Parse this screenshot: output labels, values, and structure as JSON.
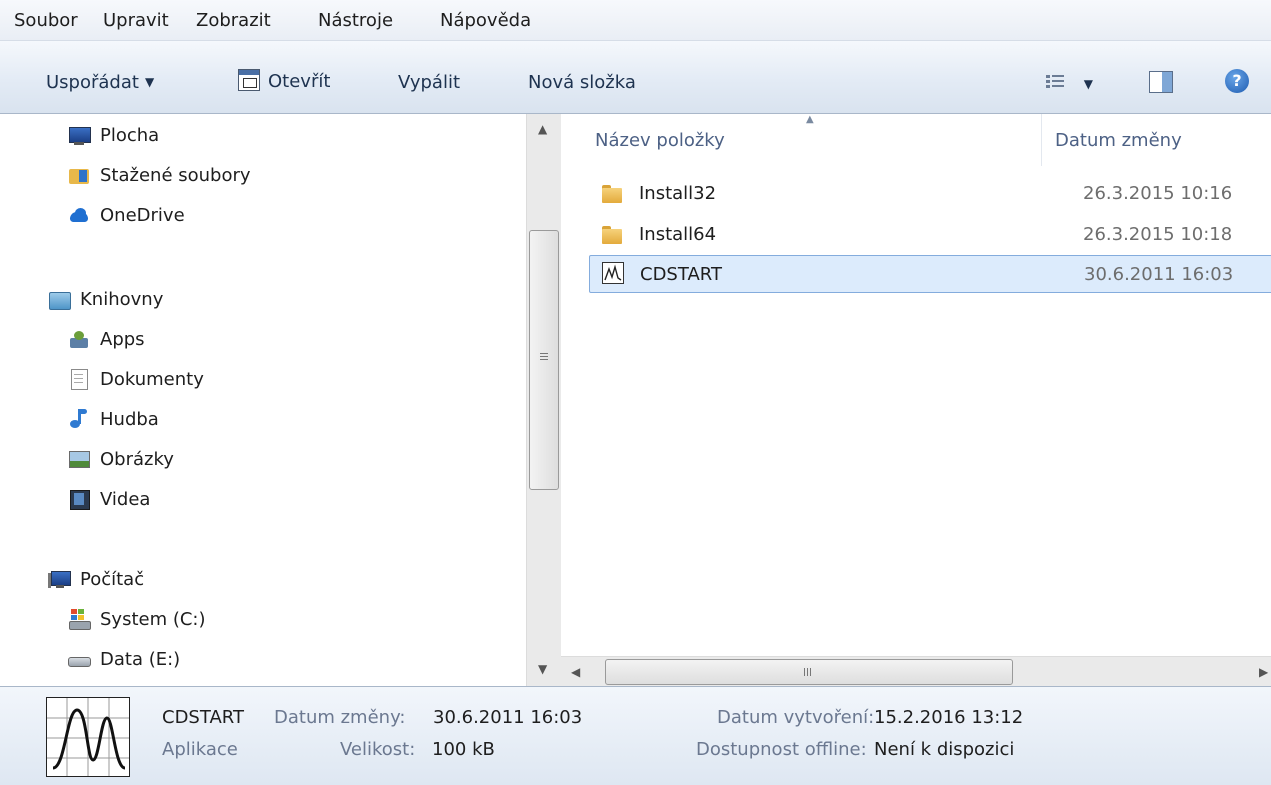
{
  "menu": {
    "file": "Soubor",
    "edit": "Upravit",
    "view": "Zobrazit",
    "tools": "Nástroje",
    "help": "Nápověda"
  },
  "toolbar": {
    "organize": "Uspořádat",
    "open": "Otevřít",
    "burn": "Vypálit",
    "new_folder": "Nová složka"
  },
  "nav": {
    "favorites": [
      {
        "label": "Plocha",
        "icon": "desktop-icon"
      },
      {
        "label": "Stažené soubory",
        "icon": "downloads-icon"
      },
      {
        "label": "OneDrive",
        "icon": "onedrive-icon"
      }
    ],
    "libraries": {
      "label": "Knihovny",
      "items": [
        {
          "label": "Apps",
          "icon": "apps-icon"
        },
        {
          "label": "Dokumenty",
          "icon": "documents-icon"
        },
        {
          "label": "Hudba",
          "icon": "music-icon"
        },
        {
          "label": "Obrázky",
          "icon": "pictures-icon"
        },
        {
          "label": "Videa",
          "icon": "videos-icon"
        }
      ]
    },
    "computer": {
      "label": "Počítač",
      "items": [
        {
          "label": "System (C:)",
          "icon": "system-drive-icon"
        },
        {
          "label": "Data (E:)",
          "icon": "drive-icon"
        }
      ]
    }
  },
  "columns": {
    "name": "Název položky",
    "date": "Datum změny"
  },
  "files": [
    {
      "name": "Install32",
      "date": "26.3.2015 10:16",
      "icon": "folder-icon"
    },
    {
      "name": "Install64",
      "date": "26.3.2015 10:18",
      "icon": "folder-icon"
    },
    {
      "name": "CDSTART",
      "date": "30.6.2011 16:03",
      "icon": "application-icon",
      "selected": true
    }
  ],
  "details": {
    "name": "CDSTART",
    "type": "Aplikace",
    "modified_label": "Datum změny:",
    "modified_value": "30.6.2011 16:03",
    "size_label": "Velikost:",
    "size_value": "100 kB",
    "created_label": "Datum vytvoření:",
    "created_value": "15.2.2016 13:12",
    "offline_label": "Dostupnost offline:",
    "offline_value": "Není k dispozici"
  },
  "colors": {
    "selection_bg": "#dcebfc",
    "selection_border": "#84acdd",
    "folder": "#e8b84a",
    "header_text": "#4d6185"
  }
}
